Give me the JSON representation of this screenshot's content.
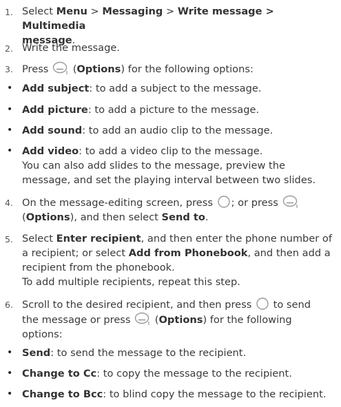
{
  "step1": {
    "num": "1.",
    "pre": "Select ",
    "b1": "Menu",
    "s1": " > ",
    "b2": "Messaging",
    "s2": " > ",
    "b3": "Write message > Multimedia",
    "b4": "message",
    "post": "."
  },
  "step2": {
    "num": "2.",
    "text": "Write the message."
  },
  "step3": {
    "num": "3.",
    "pre": "Press",
    "open": " (",
    "opt": "Options",
    "post": ") for the following options:"
  },
  "bullets1": [
    {
      "sym": "•",
      "b": "Add subject",
      "t": ": to add a subject to the message."
    },
    {
      "sym": "•",
      "b": "Add picture",
      "t": ": to add a picture to the message."
    },
    {
      "sym": "•",
      "b": "Add sound",
      "t": ": to add an audio clip to the message."
    },
    {
      "sym": "•",
      "b": "Add video",
      "t": ": to add a video clip to the message."
    }
  ],
  "video_note": [
    "You can also add slides to the message, preview the",
    "message, and set the playing interval between two slides."
  ],
  "step4": {
    "num": "4.",
    "pre": "On the message-editing screen, press",
    "mid": "; or press",
    "open": "(",
    "opt": "Options",
    "mid2": "), and then select ",
    "b": "Send to",
    "post": "."
  },
  "step5": {
    "num": "5.",
    "pre": "Select ",
    "b1": "Enter recipient",
    "mid": ", and then enter the phone number of",
    "line2_pre": "a recipient; or select ",
    "b2": "Add from Phonebook",
    "line2_post": ", and then add a",
    "line3": "recipient from the phonebook.",
    "line4": "To add multiple recipients, repeat this step."
  },
  "step6": {
    "num": "6.",
    "pre": "Scroll to the desired recipient, and then press",
    "post": " to send",
    "line2_pre": "the message or press",
    "open": " (",
    "opt": "Options",
    "line2_post": ") for the following",
    "line3": "options:"
  },
  "bullets2": [
    {
      "sym": "•",
      "b": "Send",
      "t": ": to send the message to the recipient."
    },
    {
      "sym": "•",
      "b": "Change to Cc",
      "t": ": to copy the message to the recipient."
    },
    {
      "sym": "•",
      "b": "Change to Bcc",
      "t": ": to blind copy the message to the recipient."
    }
  ],
  "icons": {
    "soft_key": "left-soft-key-icon",
    "ok_key": "ok-key-icon"
  }
}
